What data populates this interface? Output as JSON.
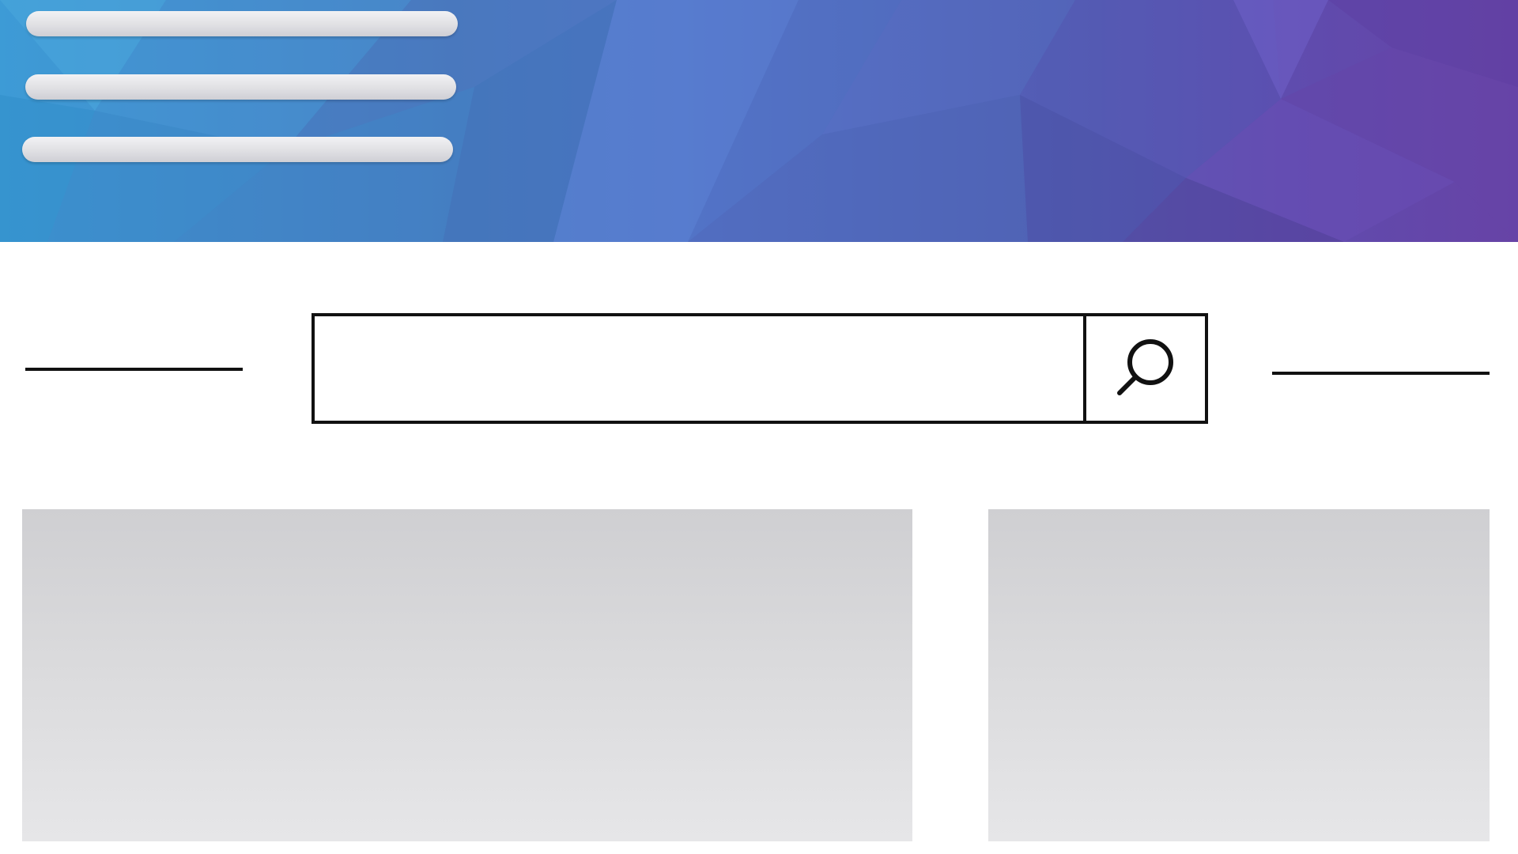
{
  "header": {
    "menu_icon": "hamburger-menu-icon",
    "gradient_colors": [
      "#3d9bd6",
      "#4a7fc4",
      "#5370c6",
      "#5b4fb0",
      "#6743a6"
    ]
  },
  "search": {
    "value": "",
    "placeholder": "",
    "button_icon": "search-icon",
    "border_color": "#111111"
  },
  "panels": {
    "fill_color": "#d8d8da"
  }
}
